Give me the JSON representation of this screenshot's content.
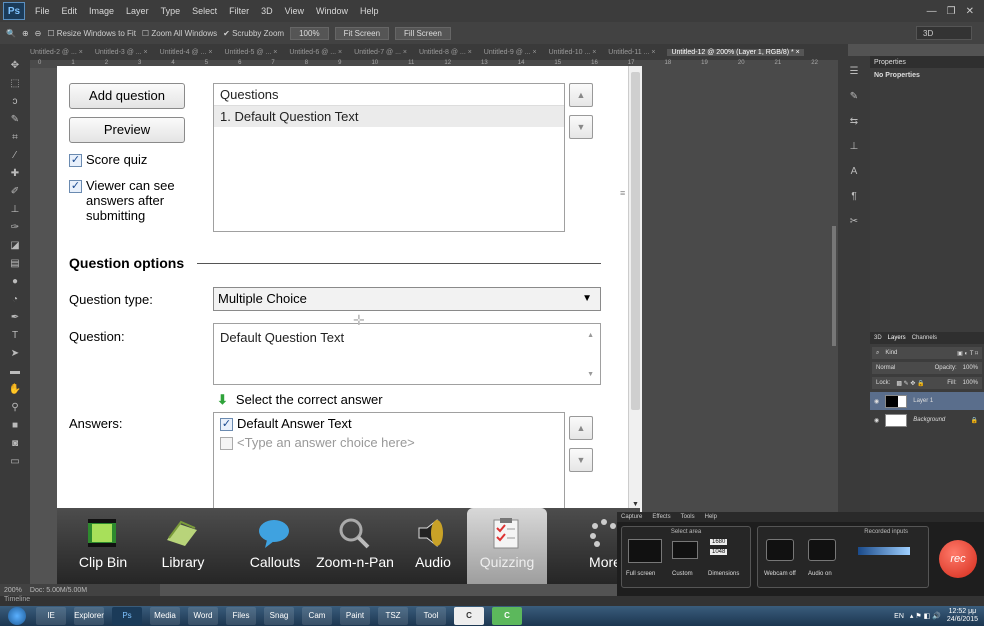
{
  "photoshop": {
    "logo": "Ps",
    "menu": [
      "File",
      "Edit",
      "Image",
      "Layer",
      "Type",
      "Select",
      "Filter",
      "3D",
      "View",
      "Window",
      "Help"
    ],
    "window_controls": [
      "—",
      "❐",
      "✕"
    ],
    "options_bar": {
      "resize_windows": "Resize Windows to Fit",
      "zoom_all": "Zoom All Windows",
      "scrubby_zoom": "Scrubby Zoom",
      "zoom_100": "100%",
      "fit_screen": "Fit Screen",
      "fill_screen": "Fill Screen",
      "workspace": "3D"
    },
    "tabs": [
      "Untitled-2 @ ... ×",
      "Untitled-3 @ ... ×",
      "Untitled-4 @ ... ×",
      "Untitled-5 @ ... ×",
      "Untitled-6 @ ... ×",
      "Untitled-7 @ ... ×",
      "Untitled-8 @ ... ×",
      "Untitled-9 @ ... ×",
      "Untitled-10 ... ×",
      "Untitled-11 ... ×"
    ],
    "active_tab": "Untitled-12 @ 200% (Layer 1, RGB/8) * ×",
    "ruler_ticks": [
      "0",
      "1",
      "2",
      "3",
      "4",
      "5",
      "6",
      "7",
      "8",
      "9",
      "10",
      "11",
      "12",
      "13",
      "14",
      "15",
      "16",
      "17",
      "18",
      "19",
      "20",
      "21",
      "22"
    ],
    "status": {
      "zoom": "200%",
      "doc": "Doc: 5.00M/5.00M"
    },
    "timeline_label": "Timeline",
    "properties": {
      "tab": "Properties",
      "body": "No Properties"
    },
    "layers": {
      "tabs": [
        "3D",
        "Layers",
        "Channels"
      ],
      "kind": "Kind",
      "blend": "Normal",
      "opacity_label": "Opacity:",
      "opacity": "100%",
      "lock_label": "Lock:",
      "fill_label": "Fill:",
      "fill": "100%",
      "items": [
        "Layer 1",
        "Background"
      ]
    }
  },
  "quiz": {
    "buttons": {
      "add_question": "Add question",
      "preview": "Preview"
    },
    "checks": {
      "score_quiz": "Score quiz",
      "viewer_can_see": "Viewer can see answers after submitting"
    },
    "questions_list": {
      "header": "Questions",
      "items": [
        "1. Default Question Text"
      ]
    },
    "section_title": "Question options",
    "question_type_label": "Question type:",
    "question_type_value": "Multiple Choice",
    "question_label": "Question:",
    "question_text": "Default Question Text",
    "hint": "Select the correct answer",
    "answers_label": "Answers:",
    "answers": [
      {
        "text": "Default Answer Text",
        "checked": true
      },
      {
        "text": "<Type an answer choice here>",
        "checked": false
      }
    ]
  },
  "camtasia_toolbar": [
    {
      "label": "Clip Bin",
      "icon": "clip-bin-icon"
    },
    {
      "label": "Library",
      "icon": "library-icon"
    },
    {
      "label": "Callouts",
      "icon": "callout-bubble-icon"
    },
    {
      "label": "Zoom-n-Pan",
      "icon": "magnifier-icon"
    },
    {
      "label": "Audio",
      "icon": "speaker-icon"
    },
    {
      "label": "Quizzing",
      "icon": "quiz-checklist-icon",
      "active": true
    },
    {
      "label": "More",
      "icon": "more-dots-icon"
    }
  ],
  "recorder": {
    "menu": [
      "Capture",
      "Effects",
      "Tools",
      "Help"
    ],
    "select_area": "Select area",
    "recorded_inputs": "Recorded inputs",
    "full_screen": "Full screen",
    "custom": "Custom",
    "dimensions": "Dimensions",
    "width": "1680",
    "height": "1048",
    "webcam": "Webcam off",
    "audio": "Audio on",
    "rec": "rec"
  },
  "taskbar": {
    "apps": [
      "IE",
      "Explorer",
      "Ps",
      "Media",
      "Word",
      "Files",
      "Snag",
      "Cam",
      "Paint",
      "TSZ",
      "Tool",
      "C",
      "C"
    ],
    "lang": "EN",
    "time": "12:52 μμ",
    "date": "24/6/2015"
  }
}
